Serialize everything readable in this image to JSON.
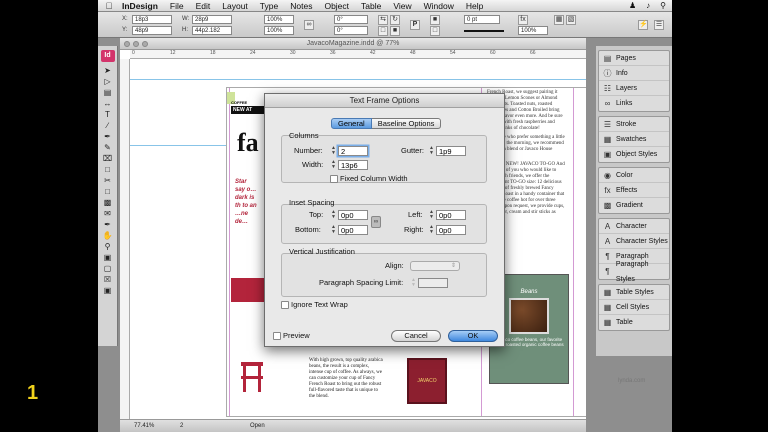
{
  "menubar": {
    "app": "InDesign",
    "items": [
      "File",
      "Edit",
      "Layout",
      "Type",
      "Notes",
      "Object",
      "Table",
      "View",
      "Window",
      "Help"
    ]
  },
  "control_panel": {
    "x": "18p3",
    "y": "48p9",
    "w": "28p9",
    "h": "44p2.182",
    "scale1": "100%",
    "scale2": "100%",
    "angle1": "0°",
    "angle2": "0°",
    "stroke": "0 pt",
    "zoom": "100%"
  },
  "document": {
    "title": "JavacoMagazine.indd @ 77%",
    "ruler_ticks": [
      "0",
      "12",
      "18",
      "24",
      "30",
      "36",
      "42",
      "48",
      "54",
      "60",
      "66"
    ],
    "content": {
      "coffee_label": "COFFEE",
      "black_bar": "NEW AT",
      "big_title": "fa",
      "red_text": "Star say o… dark is th to an …ne de… "
    }
  },
  "statusbar": {
    "zoom": "77.41%",
    "page": "2",
    "status": "Open"
  },
  "dialog": {
    "title": "Text Frame Options",
    "tabs": [
      "General",
      "Baseline Options"
    ],
    "columns": {
      "label": "Columns",
      "number_label": "Number:",
      "number_value": "2",
      "gutter_label": "Gutter:",
      "gutter_value": "1p9",
      "width_label": "Width:",
      "width_value": "13p6",
      "fixed_label": "Fixed Column Width"
    },
    "inset": {
      "label": "Inset Spacing",
      "top_label": "Top:",
      "top_value": "0p0",
      "bottom_label": "Bottom:",
      "bottom_value": "0p0",
      "left_label": "Left:",
      "left_value": "0p0",
      "right_label": "Right:",
      "right_value": "0p0"
    },
    "vjust": {
      "label": "Vertical Justification",
      "align_label": "Align:",
      "spacing_label": "Paragraph Spacing Limit:"
    },
    "ignore_wrap": "Ignore Text Wrap",
    "preview": "Preview",
    "cancel": "Cancel",
    "ok": "OK"
  },
  "panels": [
    [
      "Pages",
      "Info",
      "Layers",
      "Links"
    ],
    [
      "Stroke",
      "Swatches",
      "Object Styles"
    ],
    [
      "Color",
      "Effects",
      "Gradient"
    ],
    [
      "Character",
      "Character Styles",
      "Paragraph",
      "Paragraph Styles"
    ],
    [
      "Table Styles",
      "Cell Styles",
      "Table"
    ]
  ],
  "page_text": {
    "right_col_p1": "French Roast, we suggest pairing it with our Lemon Scones or Almond Croissants. Toasted nuts, roasted vegetables and Cotton Broiled bring out the flavor even more. And be sure to try it with fresh raspberries and large chunks of chocolate!",
    "right_col_p2": "For those who prefer something a little lighter in the morning, we recommend our Kona blend or Javaco House blend.",
    "right_col_p3": "BRAND NEW! JAVACO TO-GO And for those of you who would like to share with friends, we offer the convenient TO-GO size: 12 delicious servings of freshly brewed Fancy French Roast in a handy container that keeps the coffee hot for over three hours! Upon request, we provide cups, sweetener, cream and stir sticks as needed.",
    "beans_title": "Beans",
    "beans_caption": "Javaco coffee beans, our favorite fresh roasted organic coffee beans",
    "bottom_text": "With high grown, top quality arabica beans, the result is a complex, intense cup of coffee. As always, we can customize your cup of Fancy French Roast to bring out the robust full-flavored taste that is unique to the blend.",
    "javaco_label": "JAVACO"
  },
  "overlay": {
    "numeral": "1",
    "watermark": "lynda.com"
  }
}
